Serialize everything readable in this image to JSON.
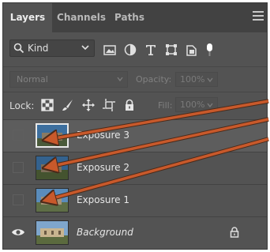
{
  "tabs": [
    {
      "label": "Layers",
      "active": true
    },
    {
      "label": "Channels",
      "active": false
    },
    {
      "label": "Paths",
      "active": false
    }
  ],
  "filter": {
    "kind_label": "Kind"
  },
  "blend": {
    "mode": "Normal",
    "opacity_label": "Opacity:",
    "opacity_value": "100%"
  },
  "lock": {
    "label": "Lock:",
    "fill_label": "Fill:",
    "fill_value": "100%"
  },
  "layers": [
    {
      "name": "Exposure 3",
      "visible": false,
      "selected": true
    },
    {
      "name": "Exposure 2",
      "visible": false,
      "selected": false
    },
    {
      "name": "Exposure 1",
      "visible": false,
      "selected": false
    },
    {
      "name": "Background",
      "visible": true,
      "selected": false,
      "locked": true
    }
  ],
  "colors": {
    "panel": "#535353",
    "tabbar": "#424242",
    "annotation_arrow": "#c8592b"
  },
  "icons": [
    "search-icon",
    "chevron-down-icon",
    "pixel-filter-icon",
    "adjustment-filter-icon",
    "type-filter-icon",
    "shape-filter-icon",
    "smart-object-filter-icon",
    "filter-toggle-icon",
    "lock-transparent-icon",
    "lock-image-icon",
    "lock-position-icon",
    "lock-artboard-icon",
    "lock-all-icon",
    "eye-icon",
    "lock-icon",
    "panel-menu-icon"
  ]
}
